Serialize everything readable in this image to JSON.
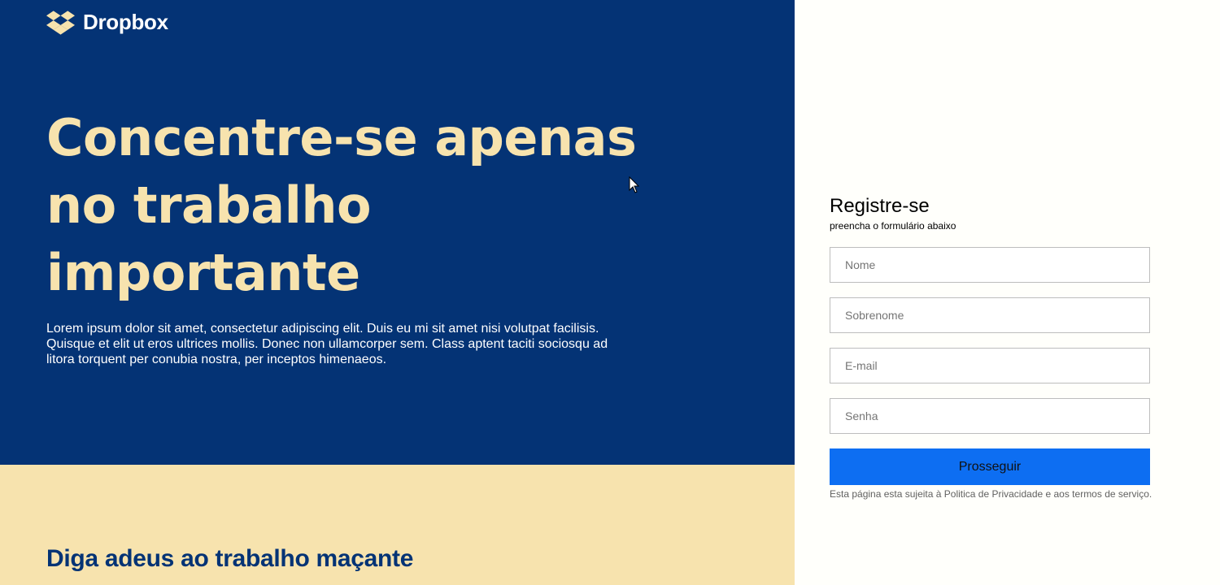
{
  "brand": {
    "name": "Dropbox",
    "logo_icon": "dropbox-box-icon",
    "colors": {
      "hero_bg": "#043375",
      "accent_cream": "#f7e3ae",
      "cta_blue": "#0d6ef2",
      "panel_bg": "#fffffb"
    }
  },
  "hero": {
    "headline": "Concentre-se apenas no trabalho importante",
    "lede": "Lorem ipsum dolor sit amet, consectetur adipiscing elit. Duis eu mi sit amet nisi volutpat facilisis. Quisque et elit ut eros ultrices mollis. Donec non ullamcorper sem. Class aptent taciti sociosqu ad litora torquent per conubia nostra, per inceptos himenaeos."
  },
  "section": {
    "heading": "Diga adeus ao trabalho maçante"
  },
  "form": {
    "title": "Registre-se",
    "subtitle": "preencha o formulário abaixo",
    "fields": {
      "first_name": {
        "placeholder": "Nome",
        "value": ""
      },
      "last_name": {
        "placeholder": "Sobrenome",
        "value": ""
      },
      "email": {
        "placeholder": "E-mail",
        "value": ""
      },
      "password": {
        "placeholder": "Senha",
        "value": ""
      }
    },
    "submit_label": "Prosseguir",
    "legal_text": "Esta página esta sujeita à Politica de Privacidade e aos termos de serviço."
  }
}
